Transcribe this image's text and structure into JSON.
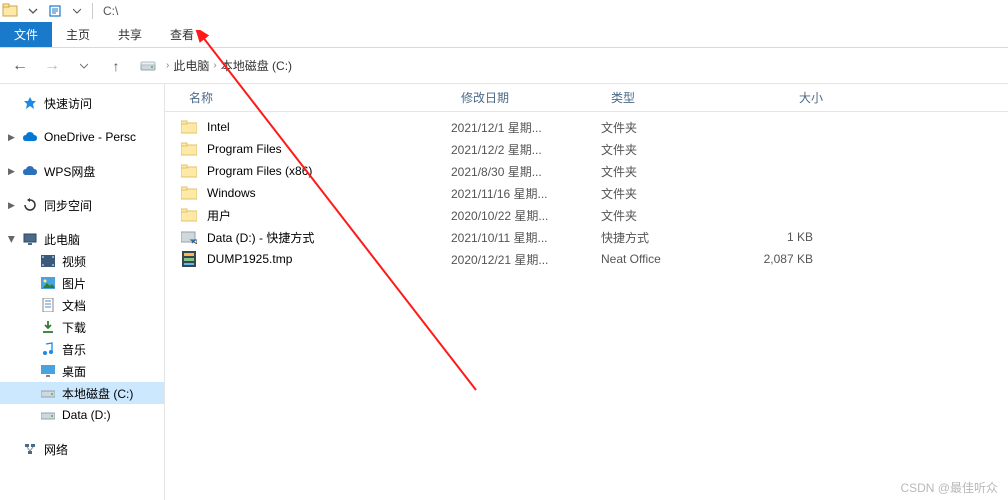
{
  "titlebar": {
    "path": "C:\\"
  },
  "ribbon": {
    "file": "文件",
    "home": "主页",
    "share": "共享",
    "view": "查看"
  },
  "breadcrumb": {
    "root": "此电脑",
    "current": "本地磁盘 (C:)",
    "sep": "›"
  },
  "columns": {
    "name": "名称",
    "date": "修改日期",
    "type": "类型",
    "size": "大小"
  },
  "sidebar": {
    "quick_access": "快速访问",
    "onedrive": "OneDrive - Persc",
    "wps": "WPS网盘",
    "sync": "同步空间",
    "this_pc": "此电脑",
    "videos": "视频",
    "pictures": "图片",
    "documents": "文档",
    "downloads": "下载",
    "music": "音乐",
    "desktop": "桌面",
    "drive_c": "本地磁盘 (C:)",
    "drive_d": "Data (D:)",
    "network": "网络"
  },
  "files": [
    {
      "name": "Intel",
      "date": "2021/12/1 星期...",
      "type": "文件夹",
      "size": "",
      "icon": "folder"
    },
    {
      "name": "Program Files",
      "date": "2021/12/2 星期...",
      "type": "文件夹",
      "size": "",
      "icon": "folder"
    },
    {
      "name": "Program Files (x86)",
      "date": "2021/8/30 星期...",
      "type": "文件夹",
      "size": "",
      "icon": "folder"
    },
    {
      "name": "Windows",
      "date": "2021/11/16 星期...",
      "type": "文件夹",
      "size": "",
      "icon": "folder"
    },
    {
      "name": "用户",
      "date": "2020/10/22 星期...",
      "type": "文件夹",
      "size": "",
      "icon": "folder"
    },
    {
      "name": "Data (D:) - 快捷方式",
      "date": "2021/10/11 星期...",
      "type": "快捷方式",
      "size": "1 KB",
      "icon": "shortcut"
    },
    {
      "name": "DUMP1925.tmp",
      "date": "2020/12/21 星期...",
      "type": "Neat Office",
      "size": "2,087 KB",
      "icon": "tmpfile"
    }
  ],
  "watermark": "CSDN @最佳听众"
}
